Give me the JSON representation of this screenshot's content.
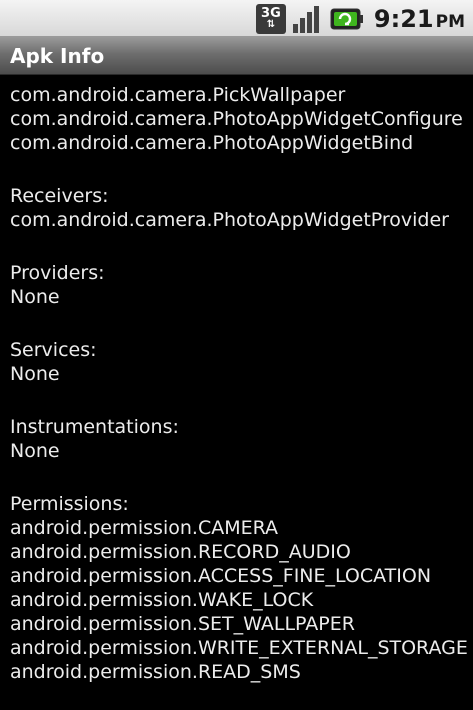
{
  "status_bar": {
    "network_label": "3G",
    "time": "9:21",
    "ampm": "PM"
  },
  "title_bar": {
    "title": "Apk Info"
  },
  "content": {
    "activities": [
      "com.android.camera.PickWallpaper",
      "com.android.camera.PhotoAppWidgetConfigure",
      "com.android.camera.PhotoAppWidgetBind"
    ],
    "receivers": {
      "header": "Receivers:",
      "items": [
        "com.android.camera.PhotoAppWidgetProvider"
      ]
    },
    "providers": {
      "header": "Providers:",
      "items": [
        "None"
      ]
    },
    "services": {
      "header": "Services:",
      "items": [
        "None"
      ]
    },
    "instrumentations": {
      "header": "Instrumentations:",
      "items": [
        "None"
      ]
    },
    "permissions": {
      "header": "Permissions:",
      "items": [
        "android.permission.CAMERA",
        "android.permission.RECORD_AUDIO",
        "android.permission.ACCESS_FINE_LOCATION",
        "android.permission.WAKE_LOCK",
        "android.permission.SET_WALLPAPER",
        "android.permission.WRITE_EXTERNAL_STORAGE",
        "android.permission.READ_SMS"
      ]
    }
  }
}
